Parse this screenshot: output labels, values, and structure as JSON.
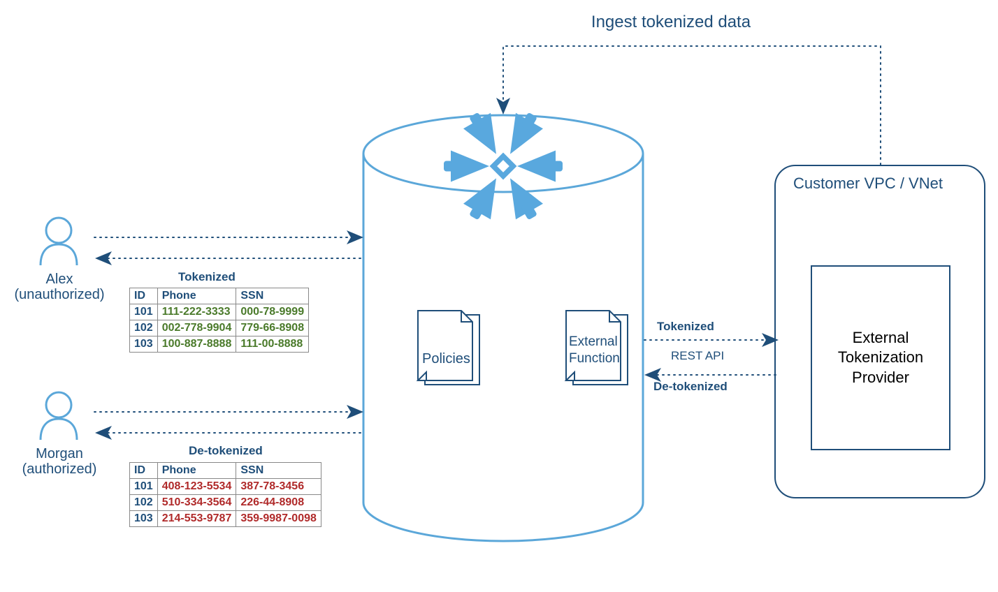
{
  "title_top": "Ingest tokenized data",
  "users": {
    "alex": {
      "name": "Alex",
      "role": "(unauthorized)"
    },
    "morgan": {
      "name": "Morgan",
      "role": "(authorized)"
    }
  },
  "tables": {
    "tokenized": {
      "title": "Tokenized",
      "headers": [
        "ID",
        "Phone",
        "SSN"
      ],
      "rows": [
        [
          "101",
          "111-222-3333",
          "000-78-9999"
        ],
        [
          "102",
          "002-778-9904",
          "779-66-8908"
        ],
        [
          "103",
          "100-887-8888",
          "111-00-8888"
        ]
      ]
    },
    "detokenized": {
      "title": "De-tokenized",
      "headers": [
        "ID",
        "Phone",
        "SSN"
      ],
      "rows": [
        [
          "101",
          "408-123-5534",
          "387-78-3456"
        ],
        [
          "102",
          "510-334-3564",
          "226-44-8908"
        ],
        [
          "103",
          "214-553-9787",
          "359-9987-0098"
        ]
      ]
    }
  },
  "cylinder": {
    "policies_label": "Policies",
    "external_function_label_line1": "External",
    "external_function_label_line2": "Function"
  },
  "rightflow": {
    "tokenized_label": "Tokenized",
    "rest_api_label": "REST API",
    "detokenized_label": "De-tokenized"
  },
  "vpc": {
    "title": "Customer VPC / VNet",
    "provider_line1": "External",
    "provider_line2": "Tokenization",
    "provider_line3": "Provider"
  },
  "colors": {
    "blueDark": "#1f4e79",
    "blueLight": "#5ba7d9",
    "greenText": "#4a7a2a",
    "redText": "#b02a2a"
  }
}
